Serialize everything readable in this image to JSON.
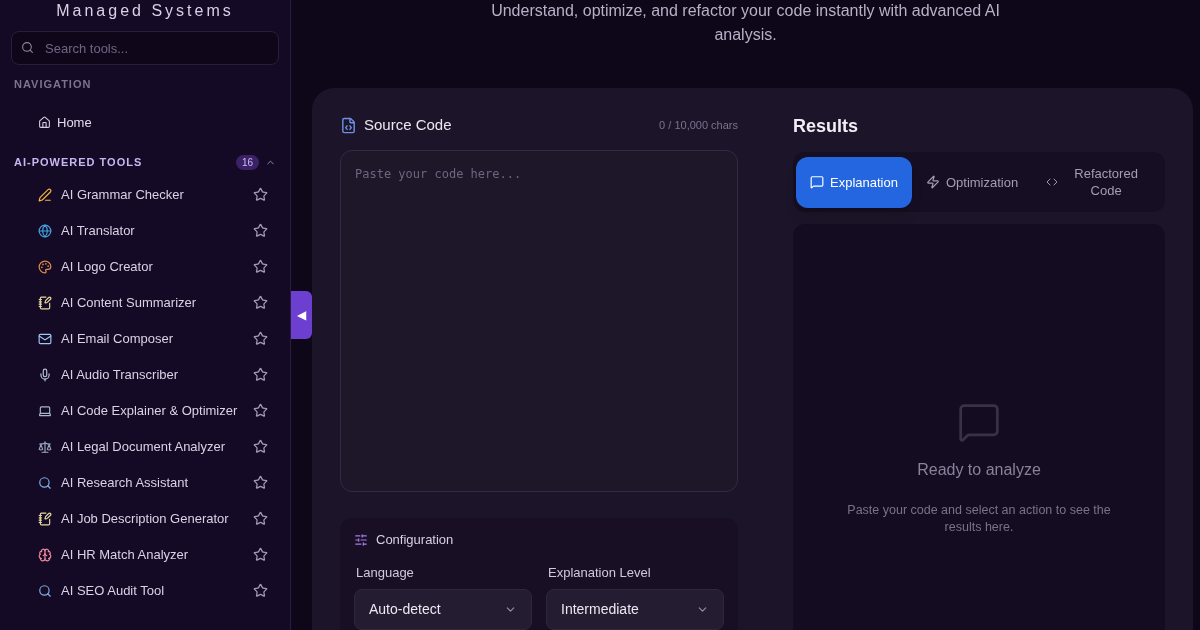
{
  "sidebar": {
    "brand": "Managed Systems",
    "search": {
      "placeholder": "Search tools..."
    },
    "nav_heading": "NAVIGATION",
    "nav_items": [
      {
        "label": "Home",
        "kind": "home"
      }
    ],
    "tools_heading": "AI-POWERED TOOLS",
    "tools_count": "16",
    "tools_expanded": true,
    "tools": [
      {
        "label": "AI Grammar Checker",
        "kind": "pen",
        "starred": false
      },
      {
        "label": "AI Translator",
        "kind": "globe",
        "starred": false
      },
      {
        "label": "AI Logo Creator",
        "kind": "palette",
        "starred": false
      },
      {
        "label": "AI Content Summarizer",
        "kind": "memo",
        "starred": false
      },
      {
        "label": "AI Email Composer",
        "kind": "mail",
        "starred": false
      },
      {
        "label": "AI Audio Transcriber",
        "kind": "mic",
        "starred": false
      },
      {
        "label": "AI Code Explainer & Optimizer",
        "kind": "laptop",
        "starred": false
      },
      {
        "label": "AI Legal Document Analyzer",
        "kind": "scale",
        "starred": false
      },
      {
        "label": "AI Research Assistant",
        "kind": "search",
        "starred": false
      },
      {
        "label": "AI Job Description Generator",
        "kind": "memo",
        "starred": false
      },
      {
        "label": "AI HR Match Analyzer",
        "kind": "brain",
        "starred": false
      },
      {
        "label": "AI SEO Audit Tool",
        "kind": "search",
        "starred": false
      }
    ],
    "collapse_handle": "◀"
  },
  "subtitle": "Understand, optimize, and refactor your code instantly with advanced AI analysis.",
  "source": {
    "title": "Source Code",
    "counter": "0 / 10,000 chars",
    "placeholder": "Paste your code here..."
  },
  "configuration": {
    "title": "Configuration",
    "fields": [
      {
        "label": "Language",
        "value": "Auto-detect"
      },
      {
        "label": "Explanation Level",
        "value": "Intermediate"
      }
    ]
  },
  "results": {
    "title": "Results",
    "tabs": [
      {
        "label": "Explanation",
        "kind": "message",
        "selected": true
      },
      {
        "label": "Optimization",
        "kind": "zap",
        "selected": false
      },
      {
        "label": "Refactored Code",
        "kind": "code",
        "selected": false
      }
    ],
    "empty_title": "Ready to analyze",
    "empty_text": "Paste your code and select an action to see the results here."
  }
}
